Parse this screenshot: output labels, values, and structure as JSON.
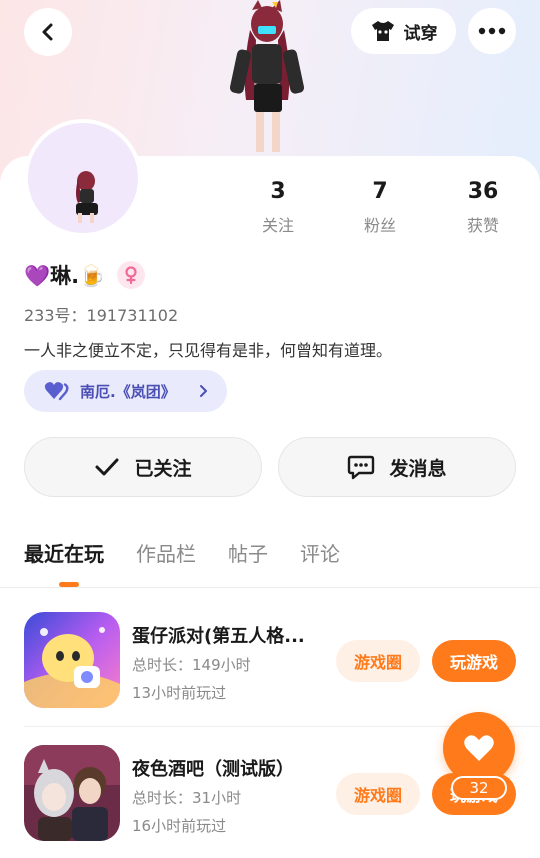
{
  "header": {
    "tryon_label": "试穿"
  },
  "profile": {
    "name": "💜琳.🍺",
    "uid_text": "233号：191731102",
    "bio": "一人非之便立不定，只见得有是非，何曾知有道理。",
    "guild_name": "南厄.《岚团》",
    "gender": "female"
  },
  "stats": [
    {
      "value": "3",
      "label": "关注"
    },
    {
      "value": "7",
      "label": "粉丝"
    },
    {
      "value": "36",
      "label": "获赞"
    }
  ],
  "actions": {
    "follow_label": "已关注",
    "message_label": "发消息"
  },
  "tabs": [
    {
      "label": "最近在玩",
      "active": true
    },
    {
      "label": "作品栏",
      "active": false
    },
    {
      "label": "帖子",
      "active": false
    },
    {
      "label": "评论",
      "active": false
    }
  ],
  "games": [
    {
      "title": "蛋仔派对(第五人格...",
      "duration": "总时长：149小时",
      "last_played": "13小时前玩过",
      "circle_label": "游戏圈",
      "play_label": "玩游戏"
    },
    {
      "title": "夜色酒吧（测试版）",
      "duration": "总时长：31小时",
      "last_played": "16小时前玩过",
      "circle_label": "游戏圈",
      "play_label": "玩游戏"
    }
  ],
  "like_fab": {
    "count": "32"
  },
  "colors": {
    "accent": "#ff7a1a",
    "guild_bg": "#e9eafc",
    "guild_text": "#4b4fb4"
  }
}
